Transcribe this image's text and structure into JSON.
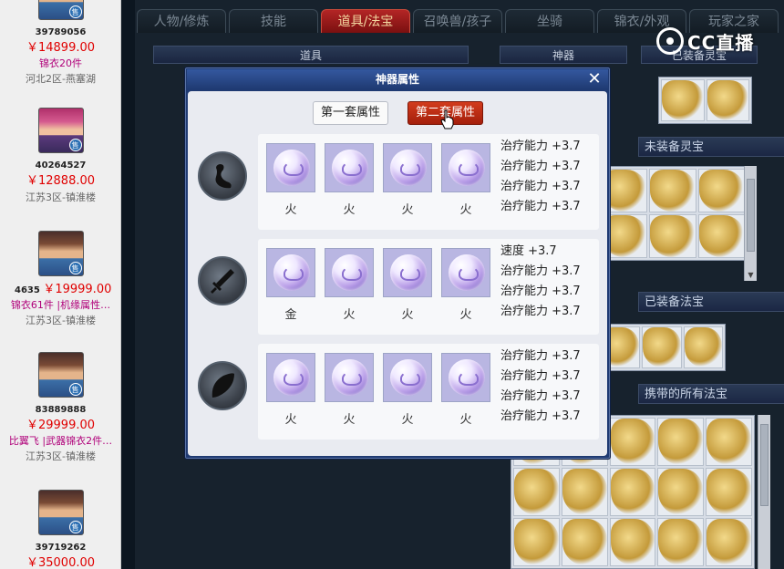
{
  "listings": [
    {
      "id": "39789056",
      "price": "￥14899.00",
      "note": "锦衣20件",
      "region": "河北2区-燕塞湖",
      "badge": "售"
    },
    {
      "id": "40264527",
      "price": "￥12888.00",
      "note": "",
      "region": "江苏3区-镇淮楼",
      "badge": "售"
    },
    {
      "id": "4635",
      "price": "￥19999.00",
      "note": "锦衣61件 |机缘属性…",
      "region": "江苏3区-镇淮楼",
      "badge": "售"
    },
    {
      "id": "83889888",
      "price": "￥29999.00",
      "note": "比翼飞 |武器锦衣2件…",
      "region": "江苏3区-镇淮楼",
      "badge": "售"
    },
    {
      "id": "39719262",
      "price": "￥35000.00",
      "note": "",
      "region": "",
      "badge": "售"
    }
  ],
  "game_tabs": [
    "人物/修炼",
    "技能",
    "道具/法宝",
    "召唤兽/孩子",
    "坐骑",
    "锦衣/外观",
    "玩家之家"
  ],
  "subheaders": {
    "items": "道具",
    "artifact": "神器",
    "equipped_lingbao": "已装备灵宝"
  },
  "sections": [
    "未装备灵宝",
    "已装备法宝",
    "携带的所有法宝"
  ],
  "watermark": "CC直播",
  "dialog": {
    "title": "神器属性",
    "tabs": [
      "第一套属性",
      "第二套属性"
    ],
    "active_tab": "第二套属性",
    "rows": [
      {
        "icon": "boot-icon",
        "elements": [
          "火",
          "火",
          "火",
          "火"
        ],
        "attributes": [
          "治疗能力 +3.7",
          "治疗能力 +3.7",
          "治疗能力 +3.7",
          "治疗能力 +3.7"
        ]
      },
      {
        "icon": "sword-icon",
        "elements": [
          "金",
          "火",
          "火",
          "火"
        ],
        "attributes": [
          "速度 +3.7",
          "治疗能力 +3.7",
          "治疗能力 +3.7",
          "治疗能力 +3.7"
        ]
      },
      {
        "icon": "leaf-icon",
        "elements": [
          "火",
          "火",
          "火",
          "火"
        ],
        "attributes": [
          "治疗能力 +3.7",
          "治疗能力 +3.7",
          "治疗能力 +3.7",
          "治疗能力 +3.7"
        ]
      }
    ]
  }
}
